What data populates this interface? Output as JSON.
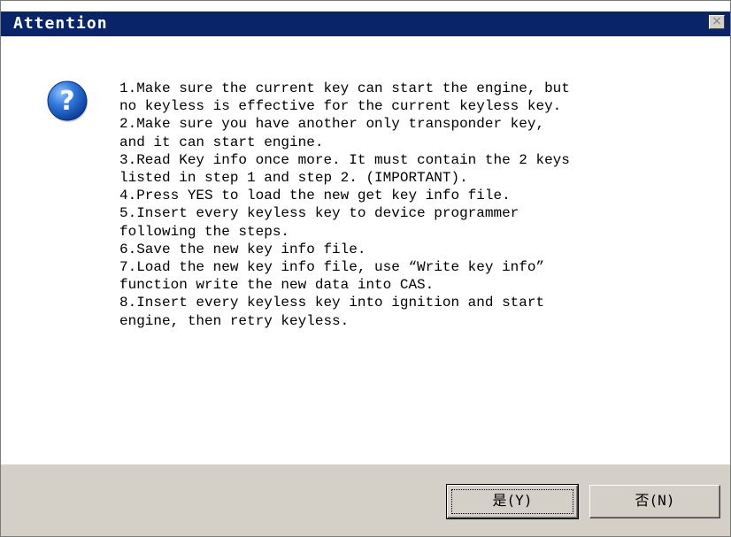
{
  "dialog": {
    "title": "Attention",
    "close_label": "×",
    "icon": "question-icon",
    "message_lines": [
      "1.Make sure the current key can start the engine, but",
      "no keyless is effective for the current keyless key.",
      "2.Make sure you have another only transponder key,",
      "and it can start engine.",
      "3.Read Key info once more. It must contain the 2 keys",
      "listed in step 1 and step 2. (IMPORTANT).",
      "4.Press YES to load the new get key info file.",
      "5.Insert every keyless key to device programmer",
      "following the steps.",
      "6.Save the new key info file.",
      "7.Load the new key info file, use “Write key info”",
      "function write the new data into CAS.",
      "8.Insert every keyless key into ignition and start",
      "engine, then retry keyless."
    ],
    "buttons": {
      "yes_label": "是(Y)",
      "no_label": "否(N)"
    }
  },
  "colors": {
    "titlebar": "#0a246a",
    "title_text": "#ffffff",
    "footer": "#d4d0c8",
    "icon_blue": "#1f5fbf"
  }
}
